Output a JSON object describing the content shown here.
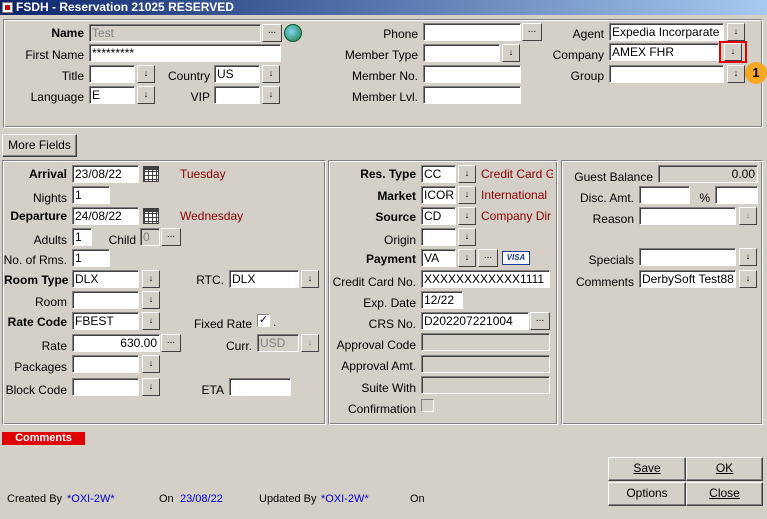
{
  "window": {
    "title": "FSDH - Reservation 21025  RESERVED"
  },
  "guest": {
    "name_label": "Name",
    "name_value": "Test",
    "first_name_label": "First Name",
    "first_name_value": "*********",
    "title_label": "Title",
    "title_value": "",
    "country_label": "Country",
    "country_value": "US",
    "language_label": "Language",
    "language_value": "E",
    "vip_label": "VIP",
    "vip_value": "",
    "phone_label": "Phone",
    "phone_value": "",
    "member_type_label": "Member Type",
    "member_type_value": "",
    "member_no_label": "Member No.",
    "member_no_value": "",
    "member_lvl_label": "Member Lvl.",
    "member_lvl_value": "",
    "agent_label": "Agent",
    "agent_value": "Expedia Incorparate",
    "company_label": "Company",
    "company_value": "AMEX FHR",
    "group_label": "Group",
    "group_value": ""
  },
  "more_fields_label": "More Fields",
  "stay": {
    "arrival_label": "Arrival",
    "arrival_value": "23/08/22",
    "arrival_day": "Tuesday",
    "nights_label": "Nights",
    "nights_value": "1",
    "departure_label": "Departure",
    "departure_value": "24/08/22",
    "departure_day": "Wednesday",
    "adults_label": "Adults",
    "adults_value": "1",
    "child_label": "Child",
    "child_value": "0",
    "rooms_label": "No. of Rms.",
    "rooms_value": "1",
    "room_type_label": "Room Type",
    "room_type_value": "DLX",
    "rtc_label": "RTC.",
    "rtc_value": "DLX",
    "room_label": "Room",
    "room_value": "",
    "rate_code_label": "Rate Code",
    "rate_code_value": "FBEST",
    "fixed_rate_label": "Fixed Rate",
    "fixed_rate_checked": "✓",
    "fixed_rate_dot": ".",
    "rate_label": "Rate",
    "rate_value": "630.00",
    "curr_label": "Curr.",
    "curr_value": "USD",
    "packages_label": "Packages",
    "packages_value": "",
    "block_code_label": "Block Code",
    "block_code_value": "",
    "eta_label": "ETA",
    "eta_value": ""
  },
  "payment": {
    "res_type_label": "Res. Type",
    "res_type_value": "CC",
    "res_type_desc": "Credit Card G",
    "market_label": "Market",
    "market_value": "ICORP",
    "market_desc": "International",
    "source_label": "Source",
    "source_value": "CD",
    "source_desc": "Company Dir",
    "origin_label": "Origin",
    "origin_value": "",
    "payment_label": "Payment",
    "payment_value": "VA",
    "visa_text": "VISA",
    "cc_no_label": "Credit Card No.",
    "cc_no_value": "XXXXXXXXXXXX1111",
    "exp_date_label": "Exp. Date",
    "exp_date_value": "12/22",
    "crs_no_label": "CRS No.",
    "crs_no_value": "D202207221004",
    "approval_code_label": "Approval Code",
    "approval_code_value": "",
    "approval_amt_label": "Approval Amt.",
    "approval_amt_value": "",
    "suite_with_label": "Suite With",
    "suite_with_value": "",
    "confirmation_label": "Confirmation"
  },
  "balance": {
    "guest_balance_label": "Guest Balance",
    "guest_balance_value": "0.00",
    "disc_amt_label": "Disc. Amt.",
    "disc_amt_value": "",
    "pct_label": "%",
    "pct_value": "",
    "reason_label": "Reason",
    "reason_value": "",
    "specials_label": "Specials",
    "specials_value": "",
    "comments_label": "Comments",
    "comments_value": "DerbySoft Test88"
  },
  "comments_tab_label": "Comments",
  "footer": {
    "created_by_label": "Created By",
    "created_by_value": "*OXI-2W*",
    "on_label": "On",
    "created_on_value": "23/08/22",
    "updated_by_label": "Updated By",
    "updated_by_value": "*OXI-2W*",
    "updated_on_label": "On",
    "updated_on_value": ""
  },
  "buttons": {
    "save": "Save",
    "ok": "OK",
    "options": "Options",
    "close": "Close"
  },
  "annotation": {
    "badge": "1"
  },
  "icons": {
    "dropdown": "↓",
    "ellipsis": "..."
  },
  "colors": {
    "title_bar": "#0a246a",
    "highlight": "#e00000",
    "badge": "#f5a623"
  }
}
